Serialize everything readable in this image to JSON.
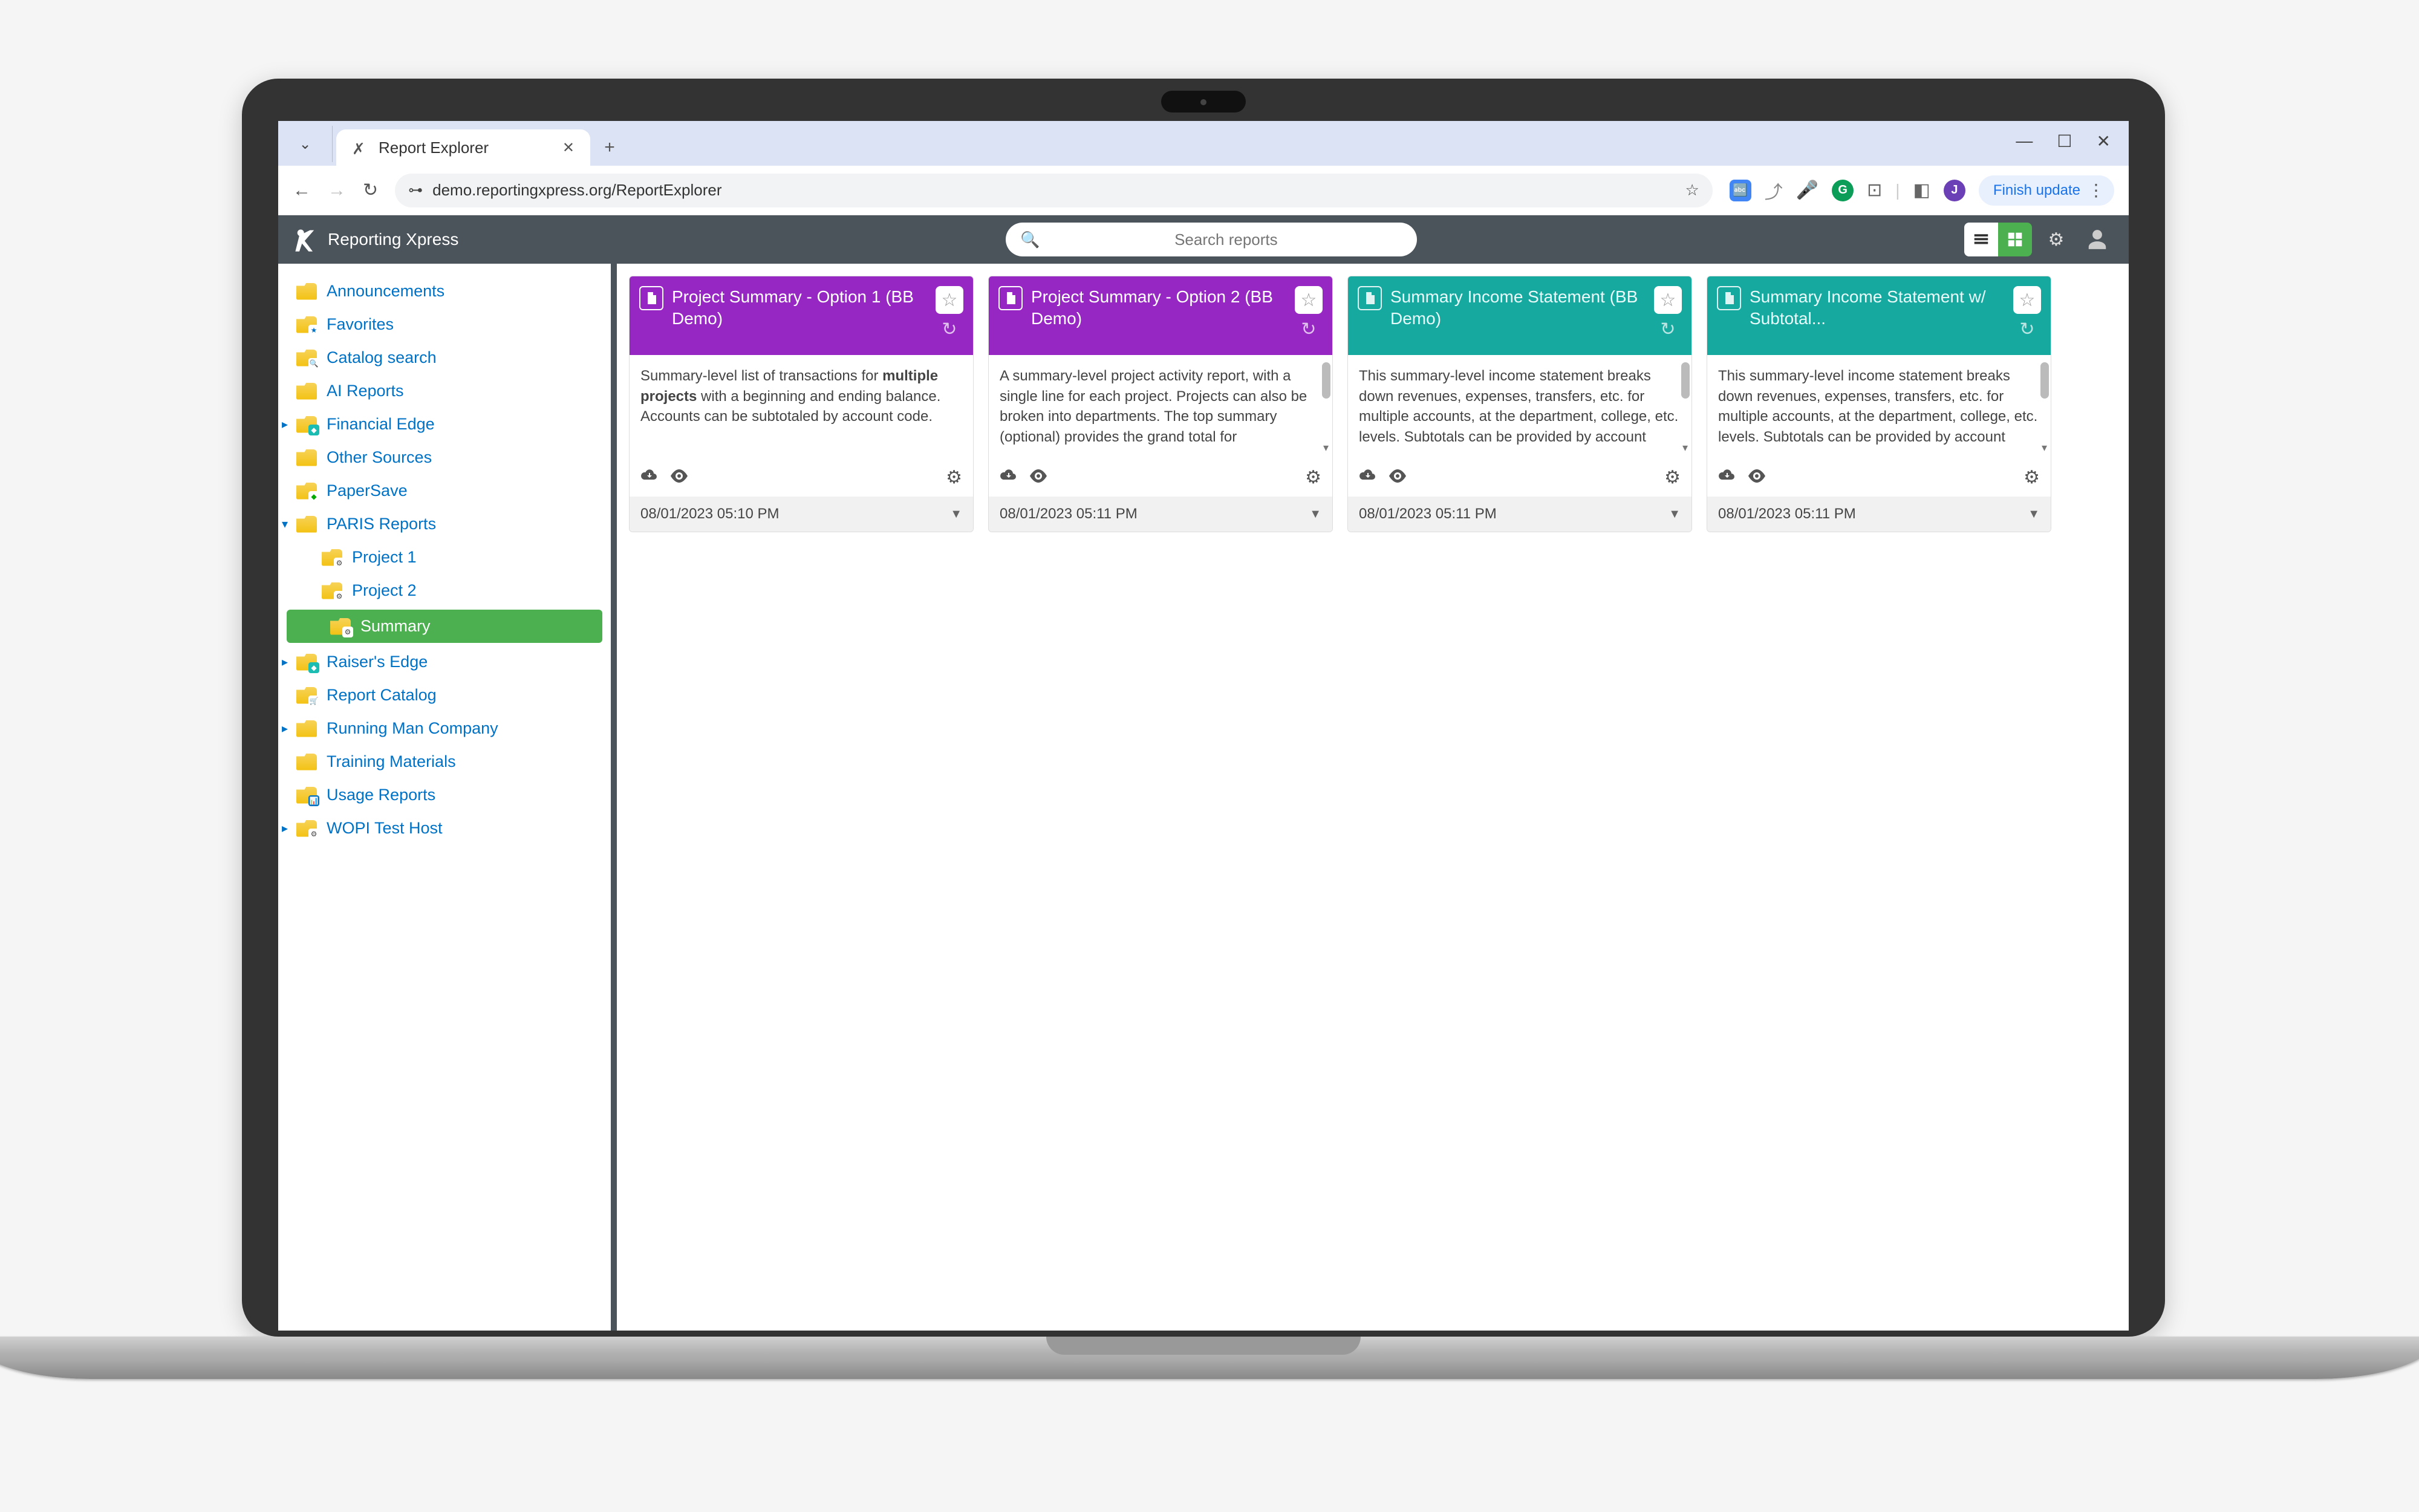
{
  "browser": {
    "tab_title": "Report Explorer",
    "url": "demo.reportingxpress.org/ReportExplorer",
    "finish_label": "Finish update",
    "profile_initial": "J"
  },
  "app": {
    "brand": "Reporting Xpress",
    "search_placeholder": "Search reports"
  },
  "sidebar": {
    "items": [
      {
        "label": "Announcements",
        "expandable": false
      },
      {
        "label": "Favorites",
        "expandable": false
      },
      {
        "label": "Catalog search",
        "expandable": false
      },
      {
        "label": "AI Reports",
        "expandable": false
      },
      {
        "label": "Financial Edge",
        "expandable": true
      },
      {
        "label": "Other Sources",
        "expandable": false
      },
      {
        "label": "PaperSave",
        "expandable": false
      },
      {
        "label": "PARIS Reports",
        "expandable": true,
        "expanded": true,
        "children": [
          {
            "label": "Project 1"
          },
          {
            "label": "Project 2"
          },
          {
            "label": "Summary",
            "active": true
          }
        ]
      },
      {
        "label": "Raiser's Edge",
        "expandable": true
      },
      {
        "label": "Report Catalog",
        "expandable": false
      },
      {
        "label": "Running Man Company",
        "expandable": true
      },
      {
        "label": "Training Materials",
        "expandable": false
      },
      {
        "label": "Usage Reports",
        "expandable": false
      },
      {
        "label": "WOPI Test Host",
        "expandable": true
      }
    ]
  },
  "reports": [
    {
      "title": "Project Summary - Option 1 (BB Demo)",
      "color": "purple",
      "description_prefix": "Summary-level list of transactions for ",
      "description_bold": "multiple projects",
      "description_suffix": " with a beginning and ending balance. Accounts can be subtotaled by account code.",
      "timestamp": "08/01/2023 05:10 PM",
      "scroll": false
    },
    {
      "title": "Project Summary - Option 2 (BB Demo)",
      "color": "purple",
      "description_prefix": "A summary-level project activity report, with a single line for each project. Projects can also be broken into departments. The top summary (optional) provides the grand total for ",
      "description_bold": "",
      "description_suffix": "",
      "timestamp": "08/01/2023 05:11 PM",
      "scroll": true
    },
    {
      "title": "Summary Income Statement (BB Demo)",
      "color": "teal",
      "description_prefix": "This summary-level income statement breaks down revenues, expenses, transfers, etc. for multiple accounts, at the department, college, etc. levels. Subtotals can be provided by account ",
      "description_bold": "",
      "description_suffix": "",
      "timestamp": "08/01/2023 05:11 PM",
      "scroll": true
    },
    {
      "title": "Summary Income Statement w/ Subtotal...",
      "color": "teal",
      "description_prefix": "This summary-level income statement breaks down revenues, expenses, transfers, etc. for multiple accounts, at the department, college, etc. levels. Subtotals can be provided by account ",
      "description_bold": "",
      "description_suffix": "",
      "timestamp": "08/01/2023 05:11 PM",
      "scroll": true
    }
  ]
}
